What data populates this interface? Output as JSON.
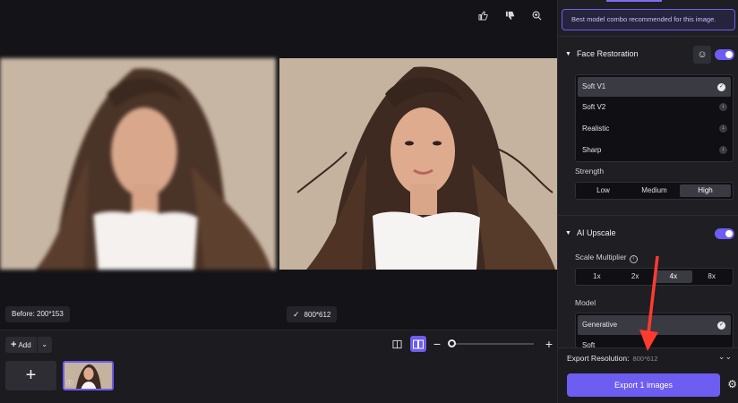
{
  "viewer": {
    "top_icons": [
      "thumbs-up-icon",
      "thumbs-down-icon",
      "zoom-in-icon"
    ],
    "before_label": "Before: 200*153",
    "after_label": "800*612"
  },
  "bottombar": {
    "add_label": "Add",
    "add_plus": "+",
    "tile_plus": "+"
  },
  "panel": {
    "recommend_text": "Best model combo recommended for this image.",
    "face_restoration": {
      "title": "Face Restoration",
      "enabled": true,
      "options": [
        "Soft V1",
        "Soft V2",
        "Realistic",
        "Sharp"
      ],
      "selected": "Soft V1",
      "strength_label": "Strength",
      "strength_options": [
        "Low",
        "Medium",
        "High"
      ],
      "strength_selected": "High"
    },
    "ai_upscale": {
      "title": "AI Upscale",
      "enabled": true,
      "scale_label": "Scale Multiplier",
      "scale_options": [
        "1x",
        "2x",
        "4x",
        "8x"
      ],
      "scale_selected": "4x",
      "model_label": "Model",
      "models": [
        "Generative",
        "Soft"
      ],
      "model_selected": "Generative"
    },
    "export": {
      "resolution_label": "Export Resolution:",
      "resolution_value": "800*612",
      "button_label": "Export 1 images"
    }
  },
  "colors": {
    "accent": "#6d5df0",
    "annotation_arrow": "#ff3b30"
  }
}
